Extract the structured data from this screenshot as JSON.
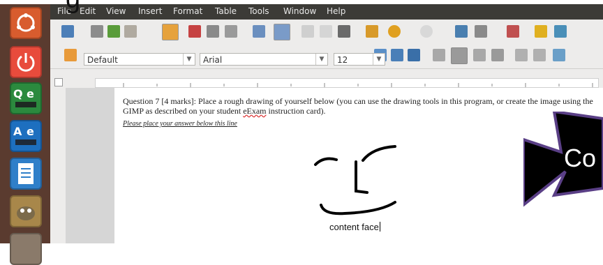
{
  "menu": [
    "File",
    "Edit",
    "View",
    "Insert",
    "Format",
    "Table",
    "Tools",
    "Window",
    "Help"
  ],
  "style_combo": {
    "value": "Default"
  },
  "font_combo": {
    "value": "Arial"
  },
  "size_combo": {
    "value": "12"
  },
  "document": {
    "question_part1": "Question 7 [4 marks]: Place a rough drawing of yourself below (you can use the drawing tools in this program, or create the image using the GIMP as described on your student",
    "question_word": "eExam",
    "question_part2": "instruction card).",
    "instruction": "Please place your answer below this line",
    "caption": "content face"
  },
  "overlay_text": "Co",
  "heading_fragment": "g",
  "colors": {
    "launcher": "#5a3b2f",
    "menubar": "#3c3b37",
    "arrow_fill": "#000000",
    "arrow_border": "#5a3f86"
  }
}
